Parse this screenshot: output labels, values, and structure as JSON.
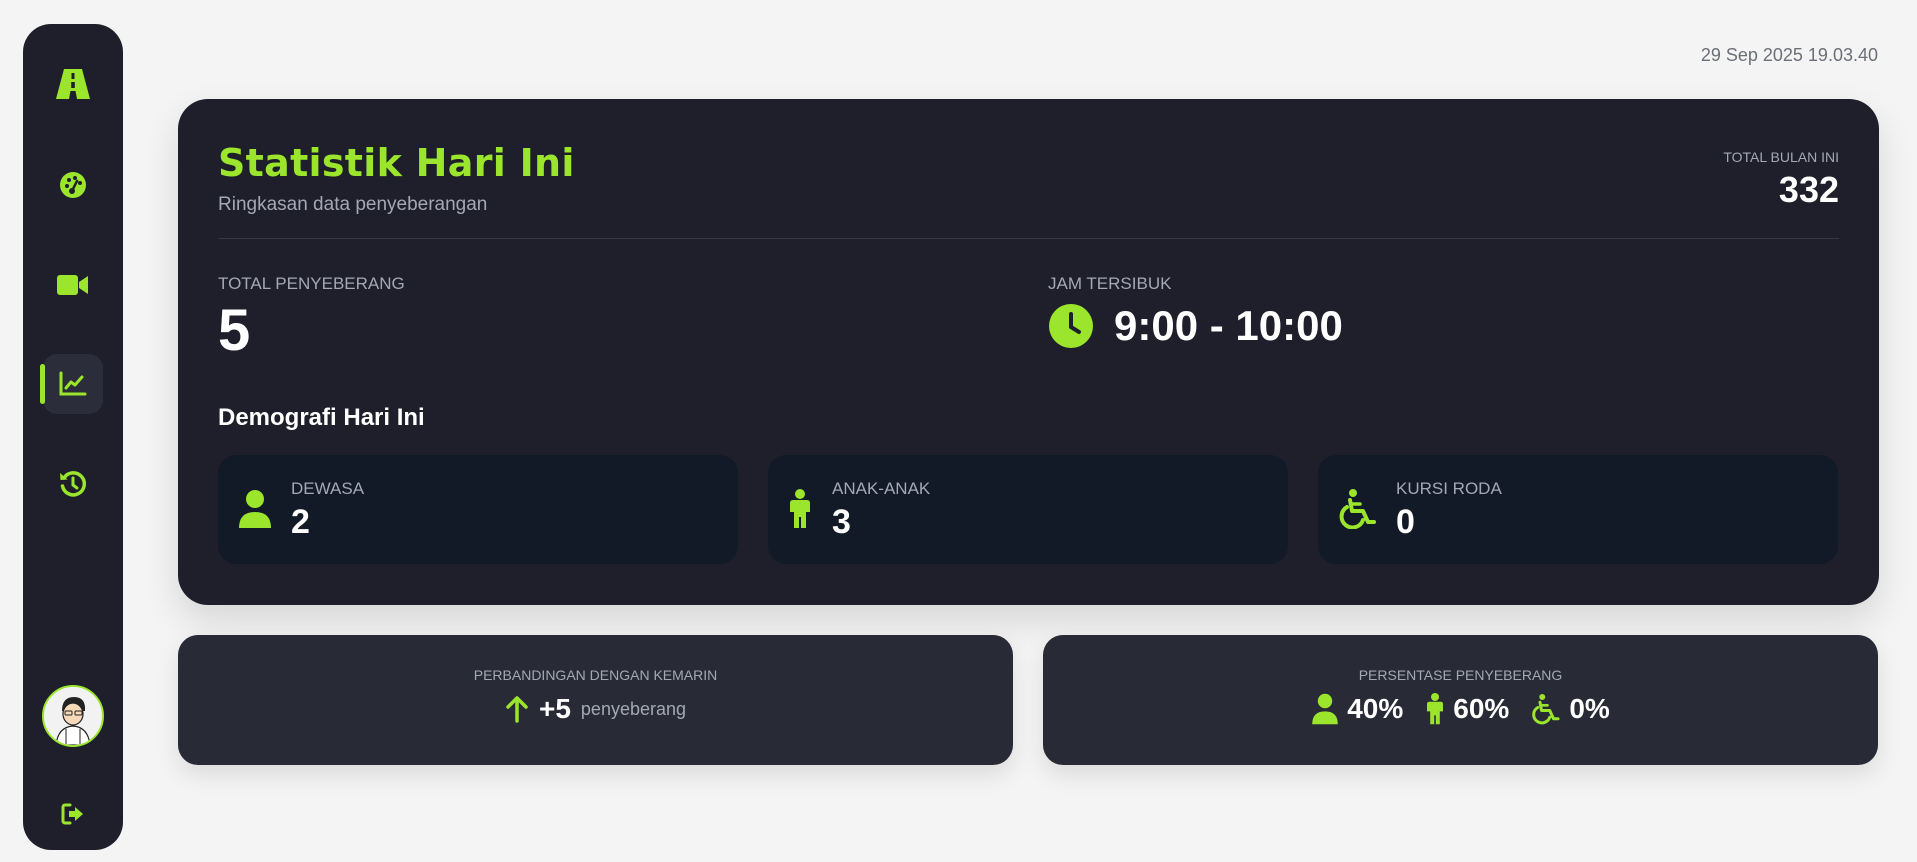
{
  "timestamp": "29 Sep 2025 19.03.40",
  "sidebar": {
    "items": [
      {
        "icon": "road-icon"
      },
      {
        "icon": "dashboard-gauge-icon"
      },
      {
        "icon": "video-camera-icon"
      },
      {
        "icon": "chart-line-icon",
        "active": true
      },
      {
        "icon": "history-icon"
      }
    ],
    "avatar": "user-avatar",
    "logout_icon": "logout-icon"
  },
  "stats": {
    "title": "Statistik Hari Ini",
    "subtitle": "Ringkasan data penyeberangan",
    "month_label": "TOTAL BULAN INI",
    "month_value": "332",
    "total_label": "TOTAL PENYEBERANG",
    "total_value": "5",
    "peak_label": "JAM TERSIBUK",
    "peak_value": "9:00 - 10:00"
  },
  "demographics": {
    "title": "Demografi Hari Ini",
    "items": [
      {
        "label": "DEWASA",
        "value": "2",
        "icon": "adult-person-icon"
      },
      {
        "label": "ANAK-ANAK",
        "value": "3",
        "icon": "child-icon"
      },
      {
        "label": "KURSI RODA",
        "value": "0",
        "icon": "wheelchair-icon"
      }
    ]
  },
  "comparison": {
    "label": "PERBANDINGAN DENGAN KEMARIN",
    "value": "+5",
    "unit": "penyeberang"
  },
  "percentage": {
    "label": "PERSENTASE PENYEBERANG",
    "items": [
      {
        "value": "40%",
        "icon": "adult-person-icon"
      },
      {
        "value": "60%",
        "icon": "child-icon"
      },
      {
        "value": "0%",
        "icon": "wheelchair-icon"
      }
    ]
  },
  "colors": {
    "accent": "#9be52d",
    "card": "#1e1f2b",
    "tile": "#121a28",
    "background": "#f4f4f4"
  }
}
